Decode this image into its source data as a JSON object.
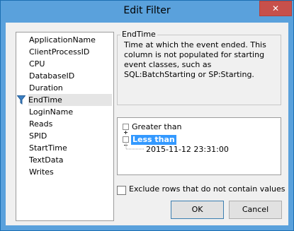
{
  "window": {
    "title": "Edit Filter",
    "close_glyph": "✕"
  },
  "columns": {
    "items": [
      "ApplicationName",
      "ClientProcessID",
      "CPU",
      "DatabaseID",
      "Duration",
      "EndTime",
      "LoginName",
      "Reads",
      "SPID",
      "StartTime",
      "TextData",
      "Writes"
    ],
    "selected": "EndTime",
    "filter_icon": "funnel-icon"
  },
  "description": {
    "title": "EndTime",
    "text": "Time at which the event ended. This column is not populated for starting event classes, such as SQL:BatchStarting or SP:Starting."
  },
  "tree": {
    "greater_than": "Greater than",
    "less_than": "Less than",
    "value": "2015-11-12 23:31:00"
  },
  "exclude": {
    "label": "Exclude rows that do not contain values",
    "checked": false
  },
  "buttons": {
    "ok": "OK",
    "cancel": "Cancel"
  },
  "colors": {
    "titlebar": "#5aa1dc",
    "close": "#c7504b",
    "selection": "#3399ff",
    "filter_icon": "#3b7fc4"
  }
}
